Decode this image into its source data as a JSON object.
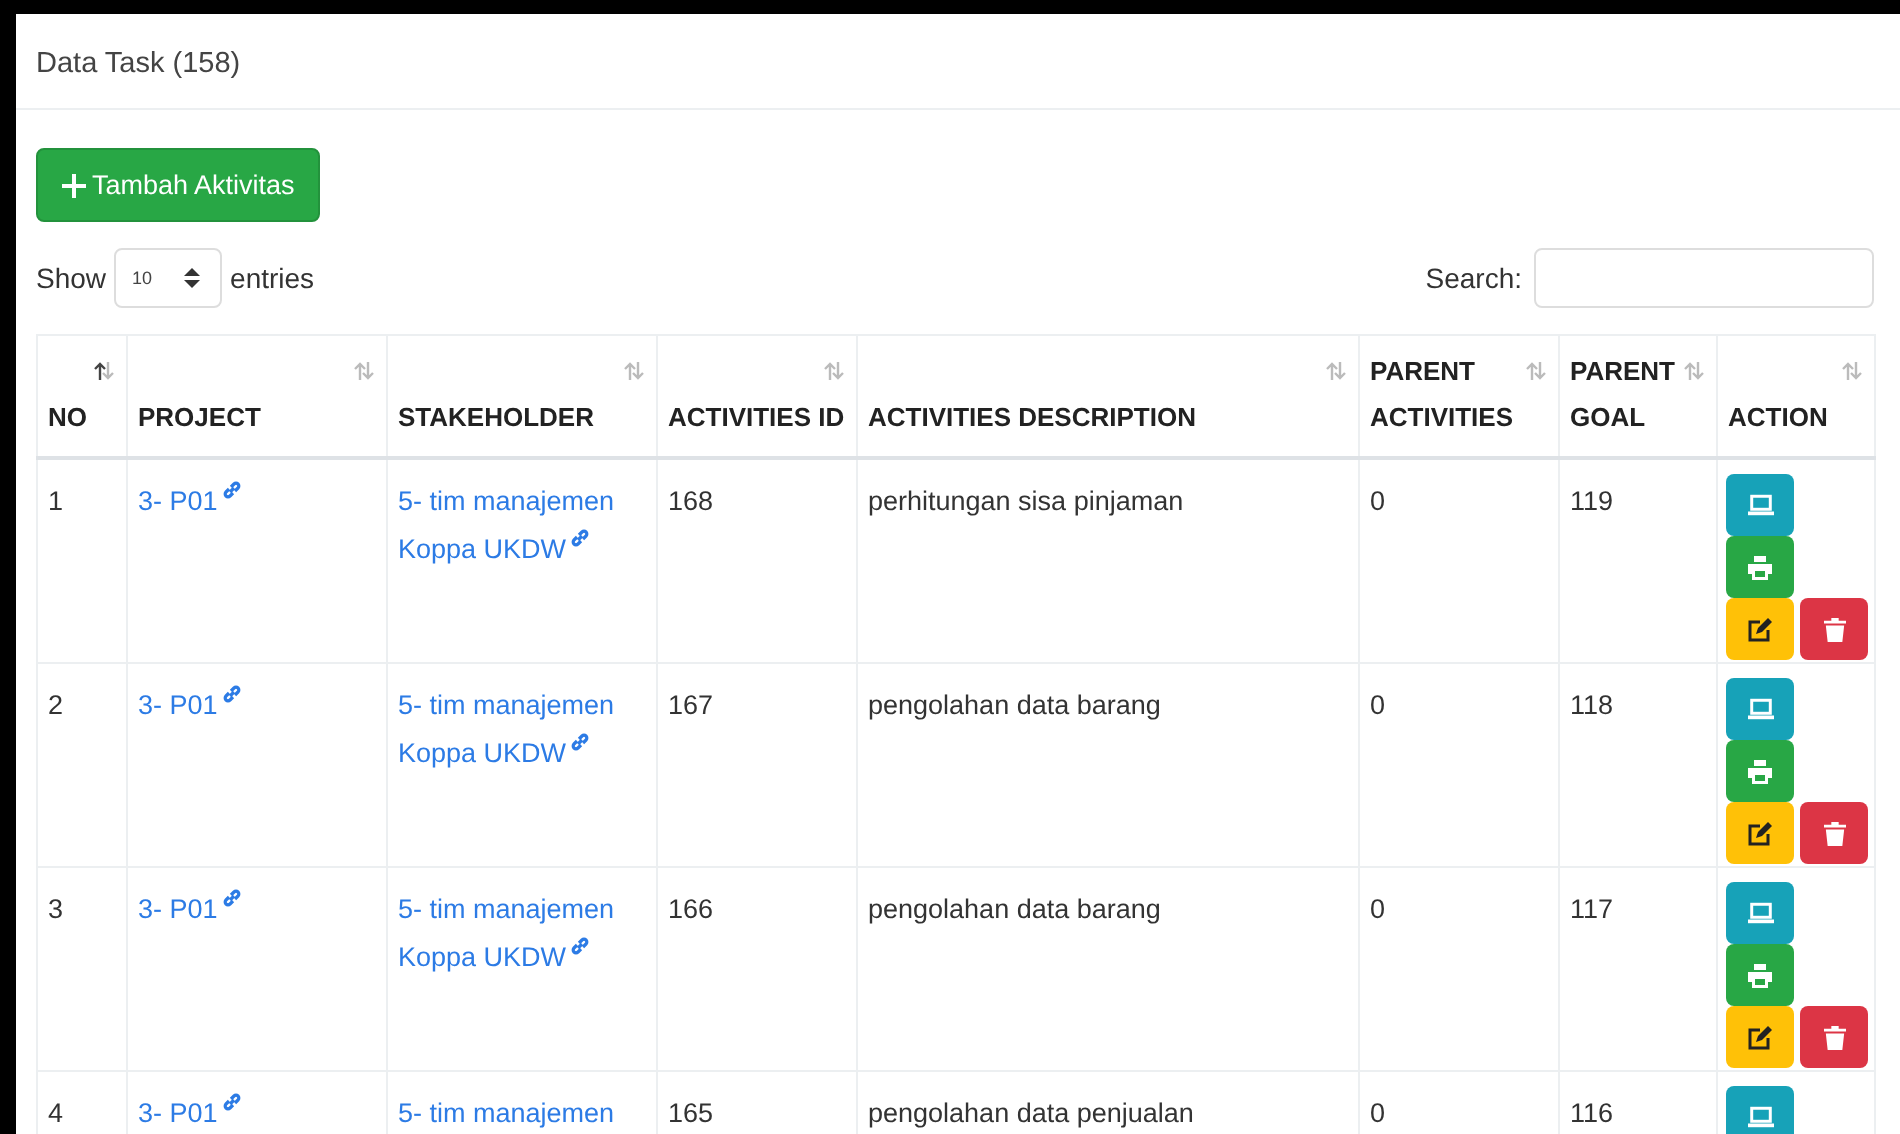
{
  "card": {
    "title": "Data Task (158)"
  },
  "add_button": {
    "label": "Tambah Aktivitas"
  },
  "length": {
    "before": "Show",
    "value": "10",
    "after": "entries"
  },
  "search": {
    "label": "Search:"
  },
  "table": {
    "columns": [
      {
        "label": "NO",
        "sorted": true
      },
      {
        "label": "PROJECT",
        "sorted": false
      },
      {
        "label": "STAKEHOLDER",
        "sorted": false
      },
      {
        "label": "ACTIVITIES ID",
        "sorted": false
      },
      {
        "label": "ACTIVITIES DESCRIPTION",
        "sorted": false
      },
      {
        "label": "PARENT ACTIVITIES",
        "sorted": false
      },
      {
        "label": "PARENT GOAL",
        "sorted": false
      },
      {
        "label": "ACTION",
        "sorted": false
      }
    ],
    "rows": [
      {
        "no": "1",
        "project": "3- P01",
        "stakeholder": "5- tim manajemen Koppa UKDW",
        "activities_id": "168",
        "description": "perhitungan sisa pinjaman",
        "parent_activities": "0",
        "parent_goal": "119",
        "actions": [
          {
            "kind": "view"
          },
          {
            "kind": "print"
          },
          {
            "kind": "edit"
          },
          {
            "kind": "delete"
          }
        ]
      },
      {
        "no": "2",
        "project": "3- P01",
        "stakeholder": "5- tim manajemen Koppa UKDW",
        "activities_id": "167",
        "description": "pengolahan data barang",
        "parent_activities": "0",
        "parent_goal": "118",
        "actions": [
          {
            "kind": "view"
          },
          {
            "kind": "print"
          },
          {
            "kind": "edit"
          },
          {
            "kind": "delete"
          }
        ]
      },
      {
        "no": "3",
        "project": "3- P01",
        "stakeholder": "5- tim manajemen Koppa UKDW",
        "activities_id": "166",
        "description": "pengolahan data barang",
        "parent_activities": "0",
        "parent_goal": "117",
        "actions": [
          {
            "kind": "view"
          },
          {
            "kind": "print"
          },
          {
            "kind": "edit"
          },
          {
            "kind": "delete"
          }
        ]
      },
      {
        "no": "4",
        "project": "3- P01",
        "stakeholder": "5- tim manajemen",
        "activities_id": "165",
        "description": "pengolahan data penjualan",
        "parent_activities": "0",
        "parent_goal": "116",
        "actions": [
          {
            "kind": "view"
          }
        ]
      }
    ]
  }
}
